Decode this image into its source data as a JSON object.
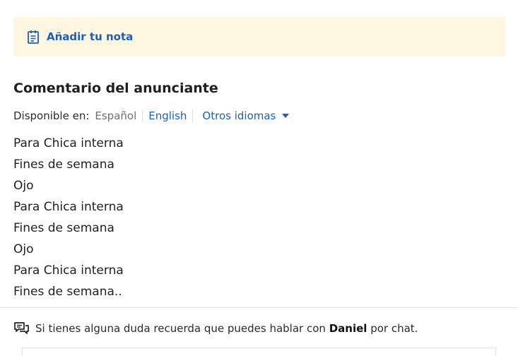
{
  "note": {
    "label": "Añadir tu nota",
    "icon": "notepad-icon"
  },
  "comment_section": {
    "title": "Comentario del anunciante",
    "available_label": "Disponible en:",
    "current_language": "Español",
    "languages": [
      "English"
    ],
    "more_languages": "Otros idiomas",
    "lines": [
      "Para Chica interna",
      "Fines de semana",
      "Ojo",
      "Para Chica interna",
      "Fines de semana",
      "Ojo",
      "Para Chica interna",
      "Fines de semana.."
    ]
  },
  "chat_hint": {
    "icon": "chat-bubbles-icon",
    "before": "Si tienes alguna duda recuerda que puedes hablar con",
    "name": "Daniel",
    "after": "por chat."
  },
  "colors": {
    "link": "#1c5fb8",
    "note_bg": "#fdf7e1",
    "muted": "#6f6f6f"
  }
}
